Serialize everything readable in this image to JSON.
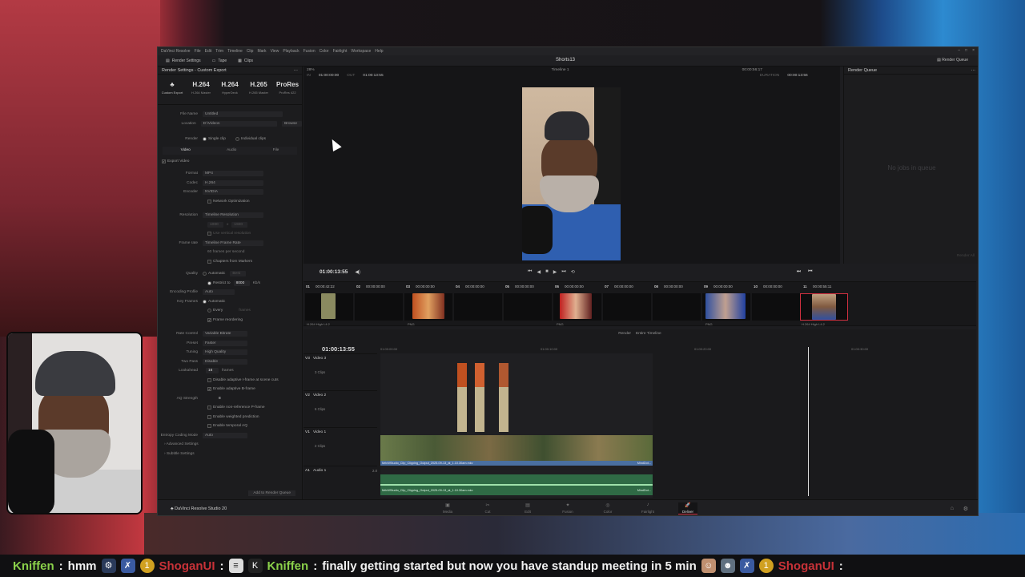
{
  "menubar": {
    "items": [
      "DaVinci Resolve",
      "File",
      "Edit",
      "Trim",
      "Timeline",
      "Clip",
      "Mark",
      "View",
      "Playback",
      "Fusion",
      "Color",
      "Fairlight",
      "Workspace",
      "Help"
    ]
  },
  "toolbar": {
    "render_settings": "Render Settings",
    "tape": "Tape",
    "clips": "Clips",
    "project": "Shorts13",
    "render_queue": "Render Queue"
  },
  "left": {
    "title": "Render Settings - Custom Export",
    "presets": [
      {
        "big": "",
        "sub": "Custom Export"
      },
      {
        "big": "H.264",
        "sub": "H.264 Master"
      },
      {
        "big": "H.264",
        "sub": "HyperDeck"
      },
      {
        "big": "H.265",
        "sub": "H.265 Master"
      },
      {
        "big": "ProRes",
        "sub": "ProRes 422"
      }
    ],
    "file_name_label": "File Name",
    "file_name": "Untitled",
    "location_label": "Location",
    "location": "D:\\Videos",
    "browse": "Browse",
    "render_label": "Render",
    "single_clip": "Single clip",
    "individual_clips": "Individual clips",
    "tabs": [
      "Video",
      "Audio",
      "File"
    ],
    "export_video": "Export Video",
    "format_label": "Format",
    "format": "MP4",
    "codec_label": "Codec",
    "codec": "H.264",
    "encoder_label": "Encoder",
    "encoder": "NVIDIA",
    "network_opt": "Network Optimization",
    "resolution_label": "Resolution",
    "resolution": "Timeline Resolution",
    "res_w": "1080",
    "res_x": "x",
    "res_h": "1920",
    "use_vertical": "Use vertical resolution",
    "frame_rate_label": "Frame rate",
    "frame_rate": "Timeline Frame Rate",
    "fps_text": "60 frames per second",
    "chapters": "Chapters from Markers",
    "quality_label": "Quality",
    "automatic": "Automatic",
    "best": "Best",
    "restrict_to": "Restrict to",
    "kbps_value": "8000",
    "kbps": "Kb/s",
    "encoding_profile_label": "Encoding Profile",
    "encoding_profile": "Auto",
    "key_frames_label": "Key Frames",
    "kf_auto": "Automatic",
    "kf_every": "Every",
    "kf_frames": "frames",
    "frame_reordering": "Frame reordering",
    "rate_control_label": "Rate Control",
    "rate_control": "Variable Bitrate",
    "preset_label": "Preset",
    "preset": "Faster",
    "tuning_label": "Tuning",
    "tuning": "High Quality",
    "two_pass_label": "Two Pass",
    "two_pass": "Disable",
    "lookahead_label": "Lookahead",
    "lookahead": "16",
    "lookahead_unit": "frames",
    "disable_adaptive_i": "Disable adaptive I-frame at scene cuts",
    "enable_adaptive_b": "Enable adaptive B-frame",
    "aq_label": "AQ Strength",
    "aq": "8",
    "enable_nonref": "Enable non-reference P-frame",
    "enable_weighted": "Enable weighted prediction",
    "enable_temporal": "Enable temporal AQ",
    "entropy_label": "Entropy Coding Mode",
    "entropy": "Auto",
    "advanced": "Advanced Settings",
    "subtitle": "Subtitle Settings",
    "add_rq": "Add to Render Queue"
  },
  "viewer": {
    "zoom": "28%",
    "timeline": "Timeline 1",
    "tc_right": "00:00:56:17",
    "in_label": "IN",
    "in_tc": "01:00:00:00",
    "out_label": "OUT",
    "out_tc": "01:00:13:55",
    "duration_label": "DURATION",
    "duration": "00:00:13:56",
    "current_tc": "01:00:13:55"
  },
  "queue": {
    "title": "Render Queue",
    "empty": "No jobs in queue",
    "render_all": "Render All"
  },
  "clips": [
    {
      "n": "01",
      "tc": "00:00:42:22",
      "label": "H.264 High L4.2"
    },
    {
      "n": "02",
      "tc": "00:00:00:00",
      "label": ""
    },
    {
      "n": "03",
      "tc": "00:00:00:00",
      "label": "PNG"
    },
    {
      "n": "04",
      "tc": "00:00:00:00",
      "label": ""
    },
    {
      "n": "05",
      "tc": "00:00:00:00",
      "label": ""
    },
    {
      "n": "06",
      "tc": "00:00:00:00",
      "label": "PNG"
    },
    {
      "n": "07",
      "tc": "00:00:00:00",
      "label": ""
    },
    {
      "n": "08",
      "tc": "00:00:00:00",
      "label": ""
    },
    {
      "n": "09",
      "tc": "00:00:00:00",
      "label": "PNG"
    },
    {
      "n": "10",
      "tc": "00:00:00:00",
      "label": ""
    },
    {
      "n": "11",
      "tc": "00:00:55:11",
      "label": "H.264 High L4.2"
    }
  ],
  "timeline": {
    "render_label": "Render",
    "render_value": "Entire Timeline",
    "tc": "01:00:13:55",
    "ruler": [
      "01:00:00:00",
      "01:00:10:00",
      "01:00:20:00",
      "01:00:30:00"
    ],
    "tracks": [
      {
        "id": "V3",
        "name": "Video 3",
        "clips": "3 Clips"
      },
      {
        "id": "V2",
        "name": "Video 2",
        "clips": "6 Clips"
      },
      {
        "id": "V1",
        "name": "Video 1",
        "clips": "2 Clips"
      },
      {
        "id": "A1",
        "name": "Audio 1",
        "clips": "2.0"
      }
    ],
    "v1_clip": "MrkWStudio_Clip_Clipping_Output_2025-09-13_at_1.10.30am.mkv",
    "a1_clip": "MrkWStudio_Clip_Clipping_Output_2025-09-13_at_1.10.30am.mkv",
    "v1_end": "MindDot...",
    "a1_end": "MindDot..."
  },
  "pagebar": {
    "logo": "DaVinci Resolve Studio 20",
    "pages": [
      "Media",
      "Cut",
      "Edit",
      "Fusion",
      "Color",
      "Fairlight",
      "Deliver"
    ],
    "active": "Deliver"
  },
  "chat": {
    "u1": "Kniffen",
    "m1": "hmm",
    "u2": "ShoganUI",
    "u3": "Kniffen",
    "m2": "finally getting started but now you have standup meeting in 5 min",
    "u4": "ShoganUI"
  }
}
